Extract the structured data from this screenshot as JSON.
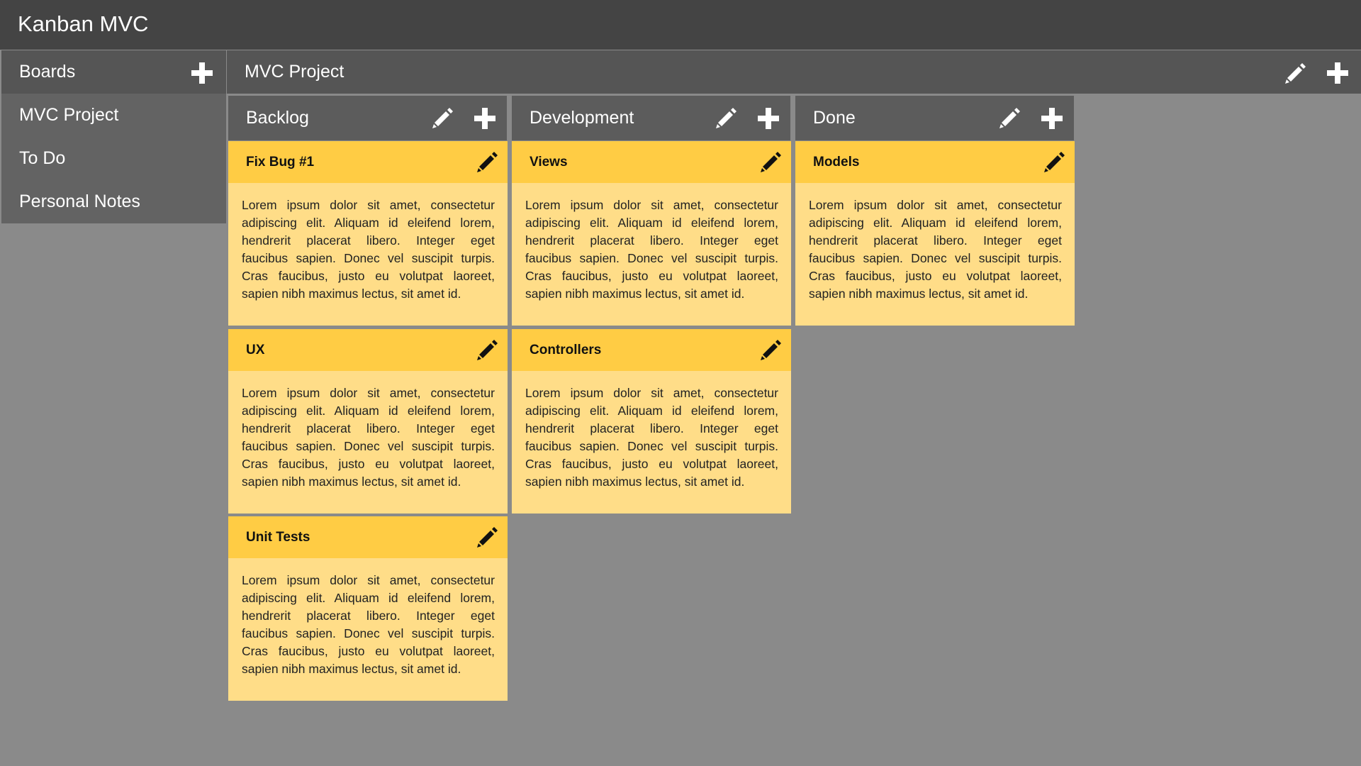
{
  "app": {
    "title": "Kanban MVC"
  },
  "sidebar": {
    "header": "Boards",
    "add_icon": "plus-icon",
    "items": [
      {
        "label": "MVC Project"
      },
      {
        "label": "To Do"
      },
      {
        "label": "Personal Notes"
      }
    ]
  },
  "board": {
    "title": "MVC Project",
    "edit_icon": "pencil-icon",
    "add_icon": "plus-icon",
    "columns": [
      {
        "title": "Backlog",
        "cards": [
          {
            "title": "Fix Bug #1",
            "body": "Lorem ipsum dolor sit amet, consectetur adipiscing elit. Aliquam id eleifend lorem, hendrerit placerat libero. Integer eget faucibus sapien. Donec vel suscipit turpis. Cras faucibus, justo eu volutpat laoreet, sapien nibh maximus lectus, sit amet id."
          },
          {
            "title": "UX",
            "body": "Lorem ipsum dolor sit amet, consectetur adipiscing elit. Aliquam id eleifend lorem, hendrerit placerat libero. Integer eget faucibus sapien. Donec vel suscipit turpis. Cras faucibus, justo eu volutpat laoreet, sapien nibh maximus lectus, sit amet id."
          },
          {
            "title": "Unit Tests",
            "body": "Lorem ipsum dolor sit amet, consectetur adipiscing elit. Aliquam id eleifend lorem, hendrerit placerat libero. Integer eget faucibus sapien. Donec vel suscipit turpis. Cras faucibus, justo eu volutpat laoreet, sapien nibh maximus lectus, sit amet id."
          }
        ]
      },
      {
        "title": "Development",
        "cards": [
          {
            "title": "Views",
            "body": "Lorem ipsum dolor sit amet, consectetur adipiscing elit. Aliquam id eleifend lorem, hendrerit placerat libero. Integer eget faucibus sapien. Donec vel suscipit turpis. Cras faucibus, justo eu volutpat laoreet, sapien nibh maximus lectus, sit amet id."
          },
          {
            "title": "Controllers",
            "body": "Lorem ipsum dolor sit amet, consectetur adipiscing elit. Aliquam id eleifend lorem, hendrerit placerat libero. Integer eget faucibus sapien. Donec vel suscipit turpis. Cras faucibus, justo eu volutpat laoreet, sapien nibh maximus lectus, sit amet id."
          }
        ]
      },
      {
        "title": "Done",
        "cards": [
          {
            "title": "Models",
            "body": "Lorem ipsum dolor sit amet, consectetur adipiscing elit. Aliquam id eleifend lorem, hendrerit placerat libero. Integer eget faucibus sapien. Donec vel suscipit turpis. Cras faucibus, justo eu volutpat laoreet, sapien nibh maximus lectus, sit amet id."
          }
        ]
      }
    ]
  },
  "colors": {
    "topbar": "#444444",
    "board_background": "#8a8a8a",
    "card_header": "#ffcc44",
    "card_body": "#ffdd88"
  }
}
